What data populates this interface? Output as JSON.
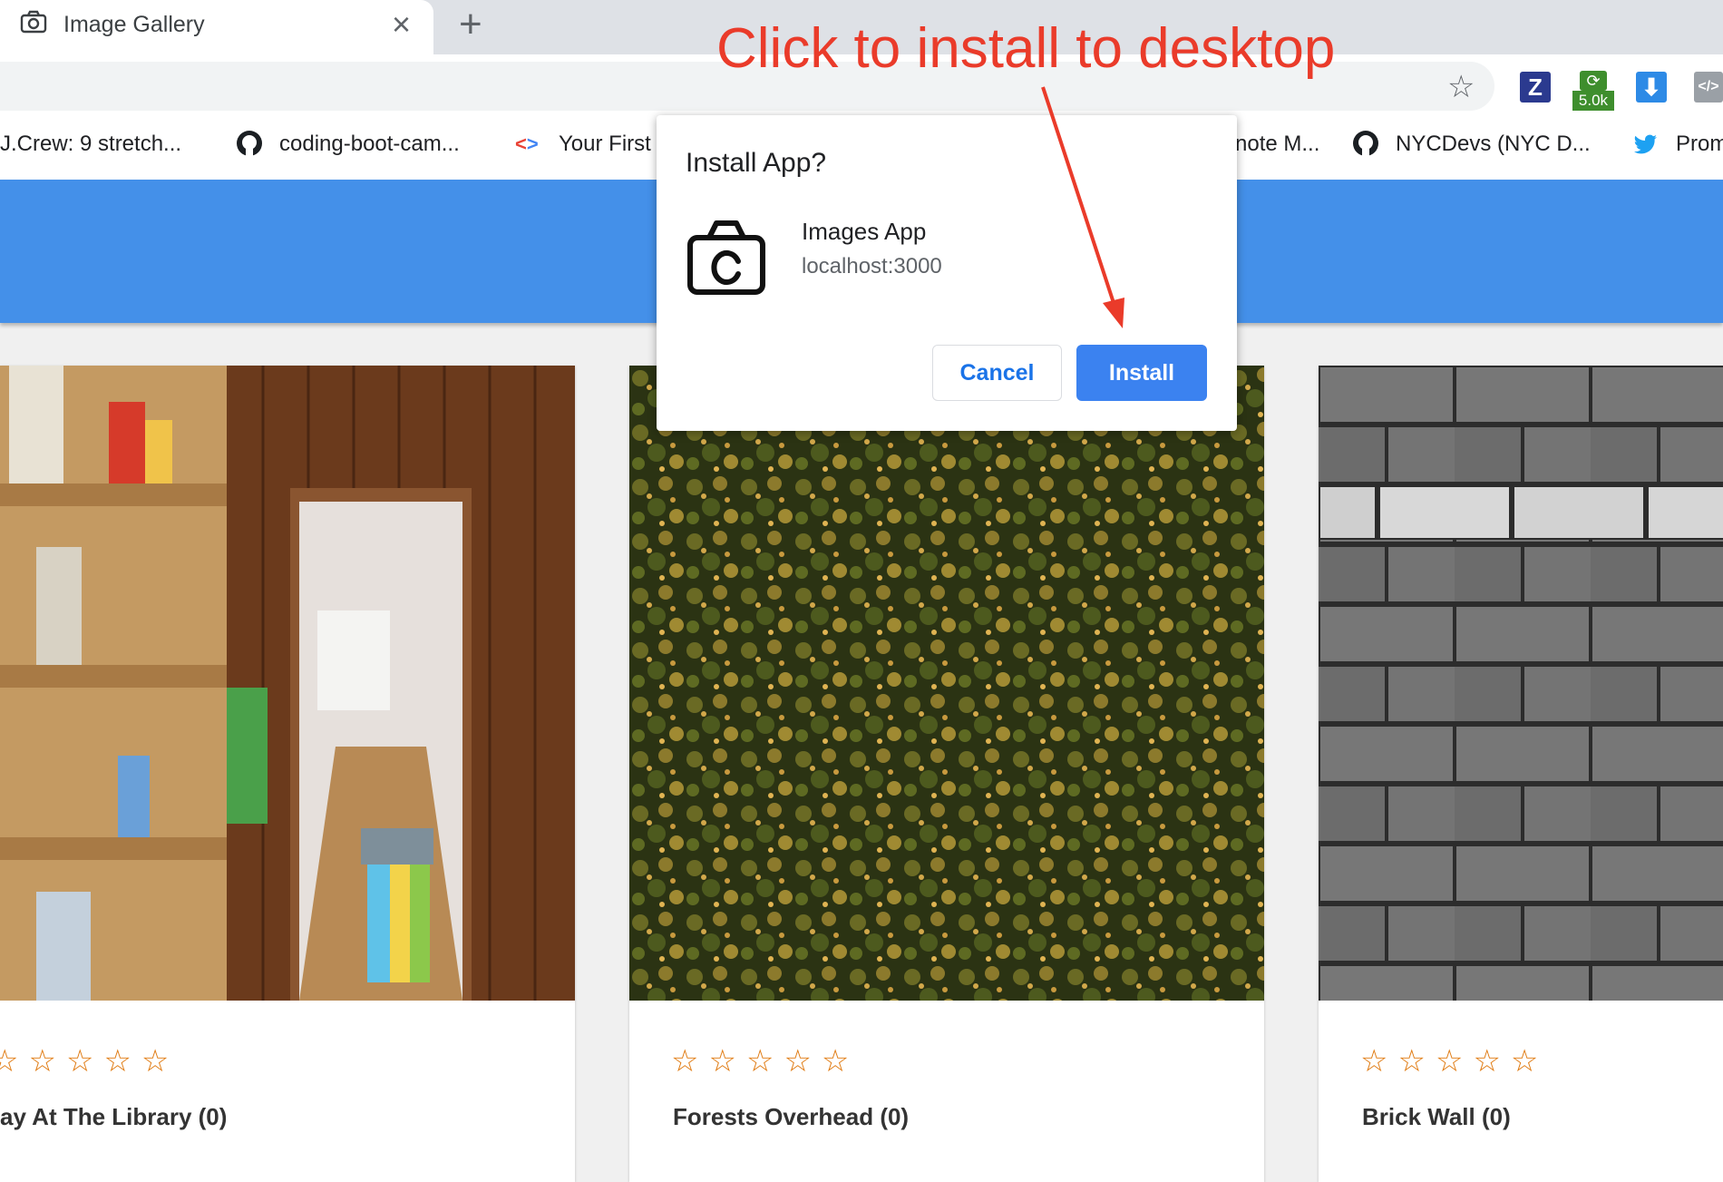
{
  "browser": {
    "tab_title": "Image Gallery",
    "tab_close_icon": "×",
    "new_tab_icon": "+",
    "star_icon": "☆",
    "extensions": [
      {
        "name": "z-extension",
        "label": "Z",
        "color": "#2b3a8f"
      },
      {
        "name": "counter-extension",
        "label": "5.0k",
        "color": "#3e8e2d"
      },
      {
        "name": "download-extension",
        "label": "⬇",
        "color": "#2d8ae6"
      },
      {
        "name": "devtools-extension",
        "label": "</>",
        "color": "#9aa0a6"
      }
    ],
    "bookmarks": [
      {
        "label": "J.Crew: 9 stretch...",
        "icon": "jcrew-icon"
      },
      {
        "label": "coding-boot-cam...",
        "icon": "github-icon"
      },
      {
        "label": "Your First",
        "icon": "code-icon"
      },
      {
        "label": "note M...",
        "icon": "none"
      },
      {
        "label": "NYCDevs (NYC D...",
        "icon": "github-icon"
      },
      {
        "label": "Prom",
        "icon": "twitter-icon"
      }
    ]
  },
  "dialog": {
    "title": "Install App?",
    "app_name": "Images App",
    "app_url": "localhost:3000",
    "cancel_label": "Cancel",
    "install_label": "Install"
  },
  "annotation": {
    "text": "Click to install to desktop",
    "color": "#ea3b2a"
  },
  "cards": [
    {
      "title": "ay At The Library (0)",
      "stars": "☆☆☆☆☆",
      "photo": "library"
    },
    {
      "title": "Forests Overhead (0)",
      "stars": "☆☆☆☆☆",
      "photo": "forest"
    },
    {
      "title": "Brick Wall (0)",
      "stars": "☆☆☆☆☆",
      "photo": "brick"
    }
  ],
  "colors": {
    "app_header": "#4490e9",
    "star": "#e07b12",
    "install_button": "#3b82f0"
  }
}
